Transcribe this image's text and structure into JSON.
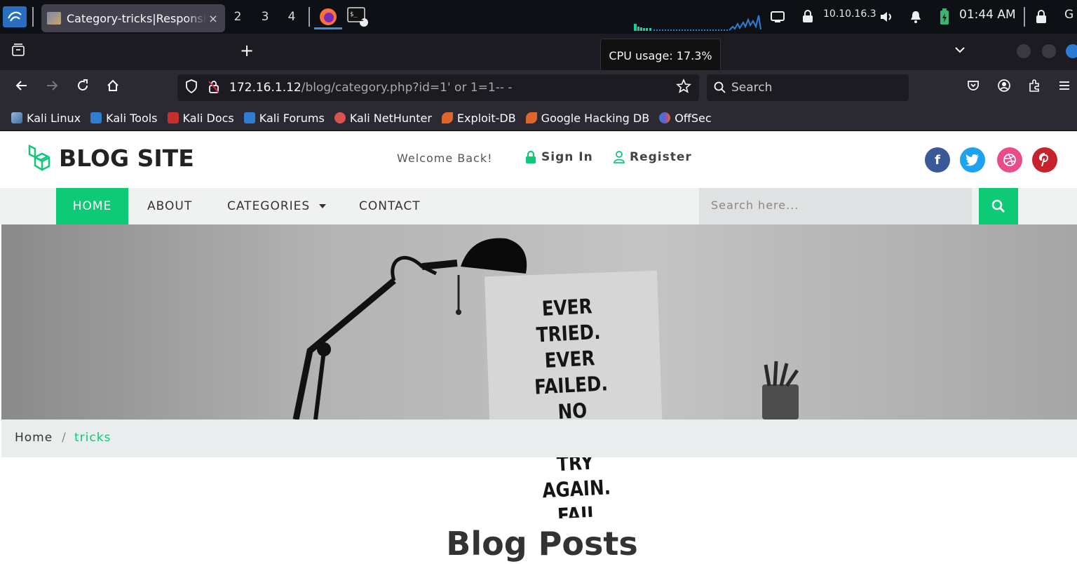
{
  "panel": {
    "workspaces": [
      "1",
      "2",
      "3",
      "4"
    ],
    "active_workspace": "1",
    "terminal_badge": "2",
    "ip_address": "10.10.16.3",
    "clock": "01:44 AM",
    "tail_text": "G"
  },
  "browser": {
    "tab_title": "Category-tricks|Responsive",
    "tab_close": "×",
    "new_tab": "+",
    "tooltip": "CPU usage: 17.3%",
    "url_host": "172.16.1.12",
    "url_path": "/blog/category.php?id=1' or 1=1-- -",
    "search_placeholder": "Search"
  },
  "bookmarks": [
    {
      "label": "Kali Linux",
      "color": "#3a6ea5"
    },
    {
      "label": "Kali Tools",
      "color": "#2f7fd1"
    },
    {
      "label": "Kali Docs",
      "color": "#c9302c"
    },
    {
      "label": "Kali Forums",
      "color": "#2f7fd1"
    },
    {
      "label": "Kali NetHunter",
      "color": "#d9534f"
    },
    {
      "label": "Exploit-DB",
      "color": "#e0652b"
    },
    {
      "label": "Google Hacking DB",
      "color": "#e0652b"
    },
    {
      "label": "OffSec",
      "color": "#6d5bd0"
    }
  ],
  "site": {
    "logo_text": "BLOG SITE",
    "welcome": "Welcome Back!",
    "sign_in": "Sign In",
    "register": "Register",
    "social": {
      "facebook": {
        "glyph": "f",
        "color": "#3b5998"
      },
      "twitter": {
        "glyph": "t",
        "color": "#1da1f2"
      },
      "dribbble": {
        "glyph": "◎",
        "color": "#ea4c89"
      },
      "pinterest": {
        "glyph": "P",
        "color": "#c8232c"
      }
    },
    "menu": {
      "home": "HOME",
      "about": "ABOUT",
      "categories": "CATEGORIES",
      "contact": "CONTACT"
    },
    "search_placeholder": "Search here...",
    "hero_poster": [
      "EVER TRIED.",
      "EVER FAILED.",
      "NO MATTER.",
      "TRY AGAIN.",
      "FAIL AGAIN."
    ],
    "breadcrumb": {
      "home": "Home",
      "separator": "/",
      "current": "tricks"
    },
    "section_title": "Blog Posts",
    "accent_color": "#0ec976"
  }
}
